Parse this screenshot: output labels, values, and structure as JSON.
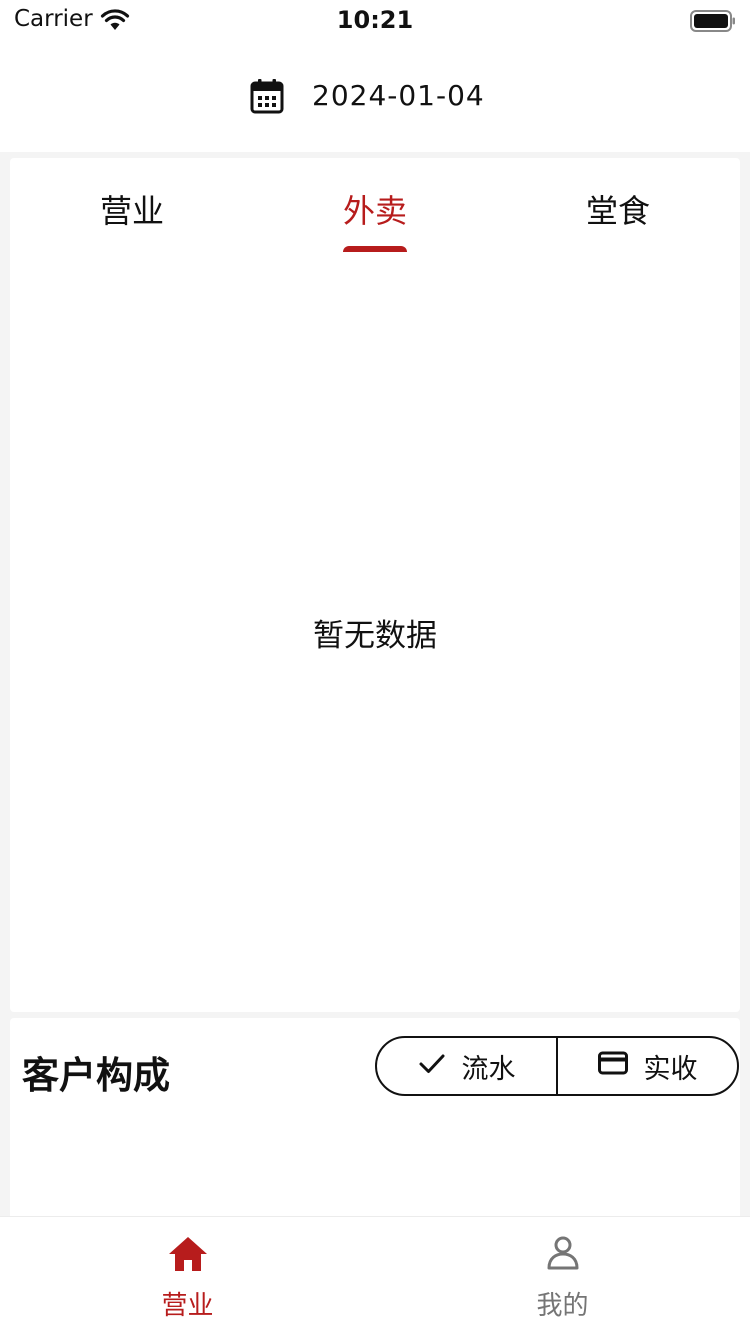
{
  "status_bar": {
    "carrier": "Carrier",
    "time": "10:21"
  },
  "header": {
    "date": "2024-01-04"
  },
  "tabs": [
    {
      "label": "营业",
      "active": false
    },
    {
      "label": "外卖",
      "active": true
    },
    {
      "label": "堂食",
      "active": false
    }
  ],
  "empty_state": {
    "text": "暂无数据"
  },
  "customer_section": {
    "title": "客户构成",
    "toggle": [
      {
        "label": "流水",
        "icon": "check-icon",
        "selected": true
      },
      {
        "label": "实收",
        "icon": "credit-card-icon",
        "selected": false
      }
    ]
  },
  "bottom_nav": [
    {
      "label": "营业",
      "icon": "home-icon",
      "active": true
    },
    {
      "label": "我的",
      "icon": "user-icon",
      "active": false
    }
  ],
  "colors": {
    "accent": "#b71c1c",
    "inactive": "#757575",
    "background": "#f4f4f4"
  }
}
